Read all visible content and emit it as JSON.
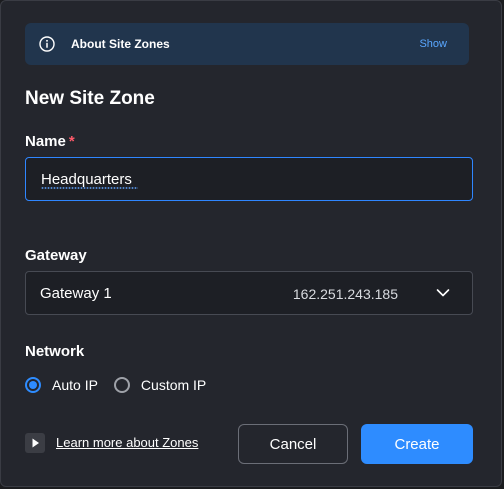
{
  "info_banner": {
    "title": "About Site Zones",
    "show_label": "Show",
    "icon": "info-icon"
  },
  "dialog": {
    "title": "New Site Zone"
  },
  "name_field": {
    "label": "Name",
    "required_marker": "*",
    "value": "Headquarters"
  },
  "gateway_field": {
    "label": "Gateway",
    "selected_name": "Gateway 1",
    "selected_ip": "162.251.243.185",
    "icon": "chevron-down-icon"
  },
  "network_field": {
    "label": "Network",
    "options": [
      {
        "label": "Auto IP",
        "selected": true
      },
      {
        "label": "Custom IP",
        "selected": false
      }
    ]
  },
  "footer": {
    "learn_more": "Learn more about Zones",
    "cancel_label": "Cancel",
    "create_label": "Create",
    "icon": "play-icon"
  },
  "colors": {
    "accent": "#2e8cff",
    "background": "#24262d",
    "banner": "#21354d",
    "required": "#ff5a6a"
  }
}
